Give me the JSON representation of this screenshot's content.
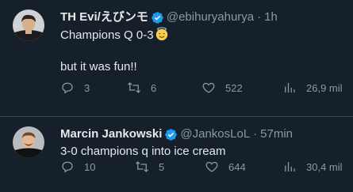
{
  "tweets": [
    {
      "display_name": "TH Evi/えびンモ",
      "handle": "@ebihuryahurya",
      "separator": "·",
      "time": "1h",
      "line1": "Champions Q 0-3",
      "line2": "but it was fun!!",
      "emoji": "smiling-face-with-halo",
      "replies": "3",
      "retweets": "6",
      "likes": "522",
      "views": "26,9 mil"
    },
    {
      "display_name": "Marcin Jankowski",
      "handle": "@JankosLoL",
      "separator": "·",
      "time": "57min",
      "line1": "3-0 champions q into ice cream",
      "replies": "10",
      "retweets": "5",
      "likes": "644",
      "views": "30,4 mil"
    }
  ],
  "colors": {
    "background": "#15202b",
    "verified": "#1d9bf0",
    "secondary_text": "#8b98a5",
    "primary_text": "#e7e9ea",
    "divider": "#38444d"
  }
}
